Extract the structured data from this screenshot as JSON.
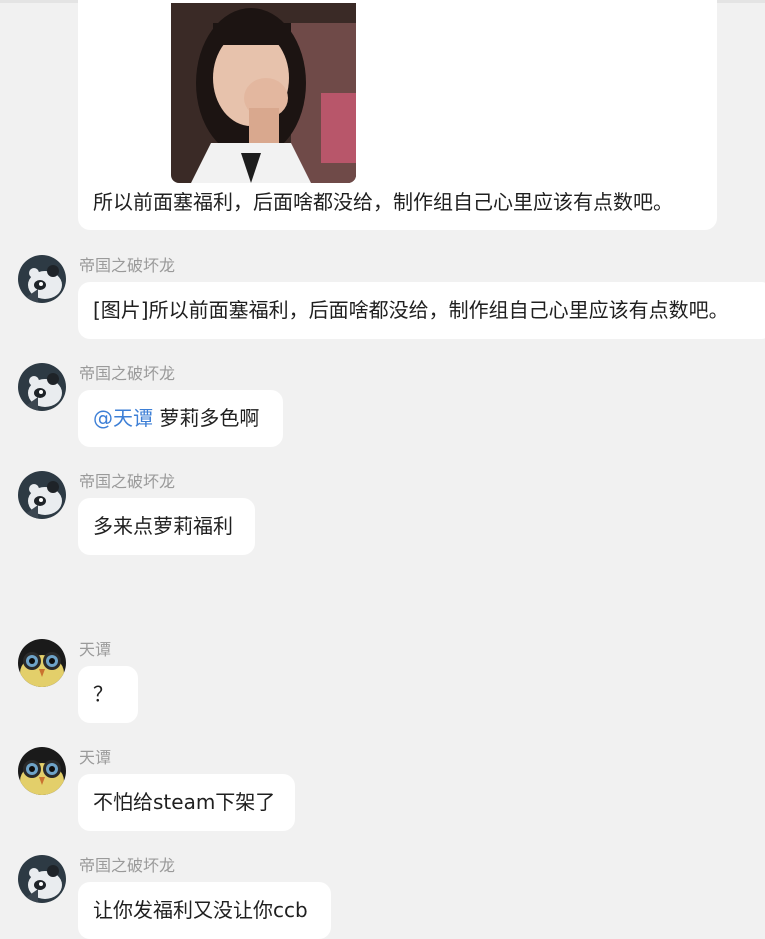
{
  "messages": [
    {
      "type": "image_text",
      "image_alt": "photo",
      "text": "所以前面塞福利，后面啥都没给，制作组自己心里应该有点数吧。"
    },
    {
      "sender": "帝国之破坏龙",
      "avatar": "panda-avatar-icon",
      "text": "[图片]所以前面塞福利，后面啥都没给，制作组自己心里应该有点数吧。"
    },
    {
      "sender": "帝国之破坏龙",
      "avatar": "panda-avatar-icon",
      "mention": "@天谭",
      "text": " 萝莉多色啊"
    },
    {
      "sender": "帝国之破坏龙",
      "avatar": "panda-avatar-icon",
      "text": "多来点萝莉福利"
    },
    {
      "sender": "天谭",
      "avatar": "owl-avatar-icon",
      "text": "？"
    },
    {
      "sender": "天谭",
      "avatar": "owl-avatar-icon",
      "text": "不怕给steam下架了"
    },
    {
      "sender": "帝国之破坏龙",
      "avatar": "panda-avatar-icon",
      "text": "让你发福利又没让你ccb"
    }
  ]
}
